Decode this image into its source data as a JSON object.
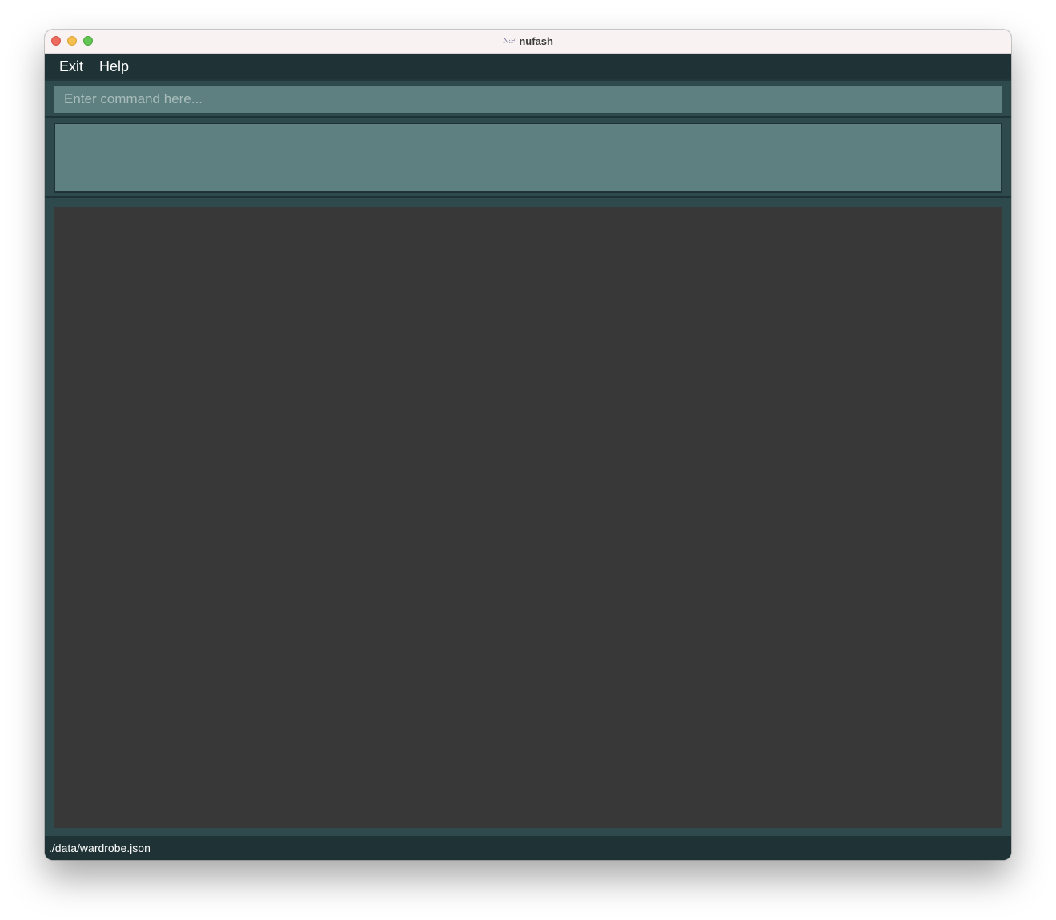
{
  "window": {
    "title": "nufash",
    "app_icon_text": "N:F"
  },
  "menu": {
    "items": [
      {
        "label": "Exit"
      },
      {
        "label": "Help"
      }
    ]
  },
  "command_box": {
    "placeholder": "Enter command here...",
    "value": ""
  },
  "result_display": {
    "text": ""
  },
  "status_bar": {
    "save_location": "./data/wardrobe.json"
  },
  "colors": {
    "menu_bar": "#1f3336",
    "panel_background": "#2e4a4c",
    "input_background": "#5f8080",
    "list_background": "#383838"
  }
}
